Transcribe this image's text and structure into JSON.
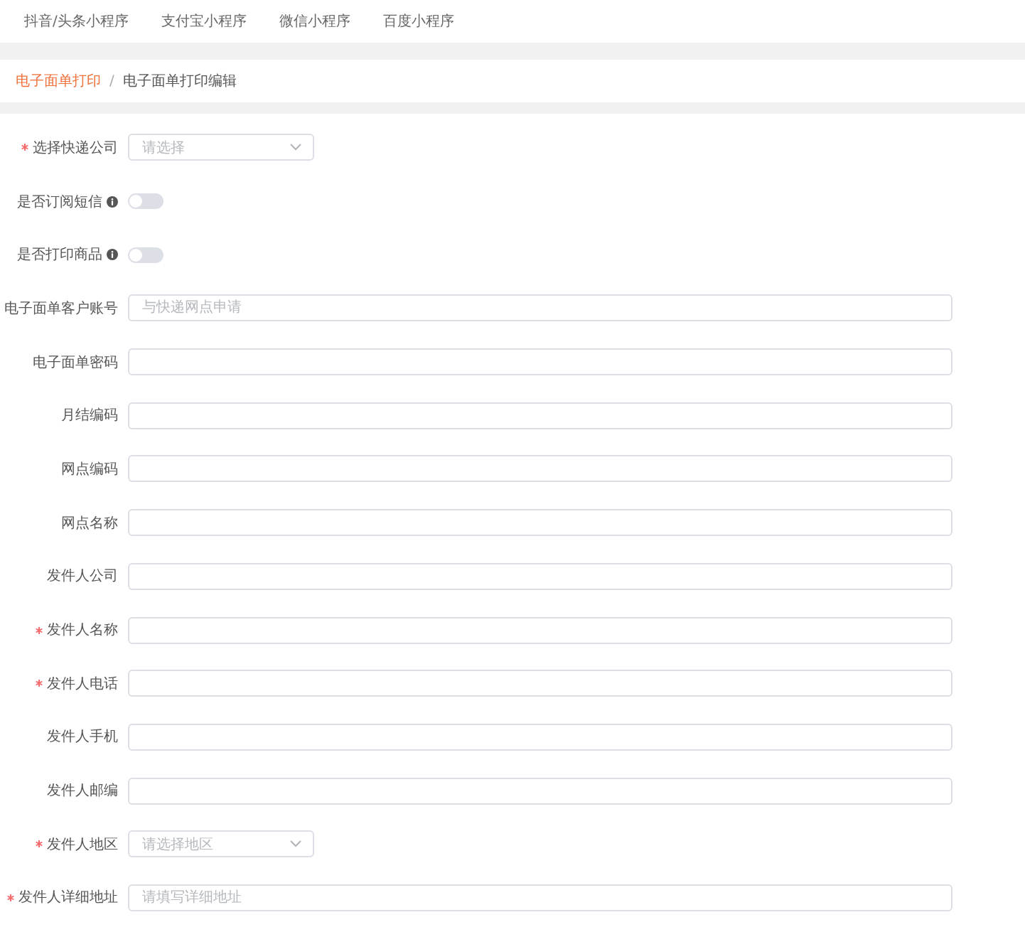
{
  "tabs": [
    {
      "label": "抖音/头条小程序"
    },
    {
      "label": "支付宝小程序"
    },
    {
      "label": "微信小程序"
    },
    {
      "label": "百度小程序"
    }
  ],
  "breadcrumb": [
    {
      "label": "电子面单打印",
      "kind": "link"
    },
    {
      "label": "电子面单打印编辑",
      "kind": "current"
    }
  ],
  "breadcrumb_separator": "/",
  "form": [
    {
      "kind": "select",
      "label": "选择快递公司",
      "required": true,
      "placeholder": "请选择"
    },
    {
      "kind": "switch",
      "label": "是否订阅短信",
      "required": false,
      "on": false,
      "info": true
    },
    {
      "kind": "switch",
      "label": "是否打印商品",
      "required": false,
      "on": false,
      "info": true
    },
    {
      "kind": "input",
      "label": "电子面单客户账号",
      "required": false,
      "placeholder": "与快递网点申请"
    },
    {
      "kind": "input",
      "label": "电子面单密码",
      "required": false
    },
    {
      "kind": "input",
      "label": "月结编码",
      "required": false
    },
    {
      "kind": "input",
      "label": "网点编码",
      "required": false
    },
    {
      "kind": "input",
      "label": "网点名称",
      "required": false
    },
    {
      "kind": "input",
      "label": "发件人公司",
      "required": false
    },
    {
      "kind": "input",
      "label": "发件人名称",
      "required": true
    },
    {
      "kind": "input",
      "label": "发件人电话",
      "required": true
    },
    {
      "kind": "input",
      "label": "发件人手机",
      "required": false
    },
    {
      "kind": "input",
      "label": "发件人邮编",
      "required": false
    },
    {
      "kind": "select",
      "label": "发件人地区",
      "required": true,
      "placeholder": "请选择地区"
    },
    {
      "kind": "input",
      "label": "发件人详细地址",
      "required": true,
      "placeholder": "请填写详细地址"
    }
  ]
}
